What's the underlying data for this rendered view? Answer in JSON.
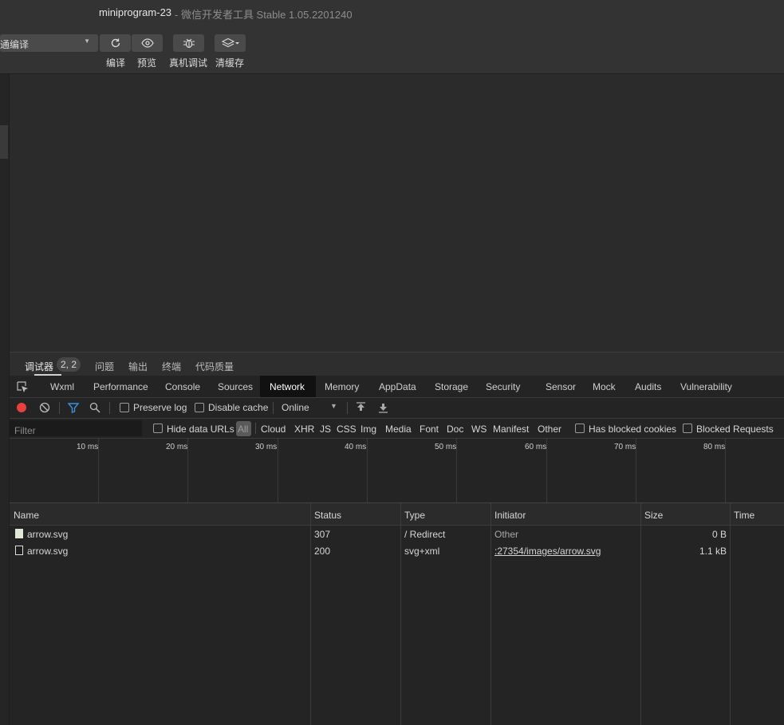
{
  "window": {
    "title": "miniprogram-23",
    "subtitle": "- 微信开发者工具 Stable 1.05.2201240"
  },
  "toolbar": {
    "compile_mode": "通编译",
    "buttons": [
      {
        "label": "编译",
        "icon": "refresh-icon"
      },
      {
        "label": "预览",
        "icon": "eye-icon"
      },
      {
        "label": "真机调试",
        "icon": "bug-icon"
      },
      {
        "label": "清缓存",
        "icon": "layers-icon"
      }
    ]
  },
  "panel_tabs": {
    "debugger": "调试器",
    "badge": "2, 2",
    "issues": "问题",
    "output": "输出",
    "terminal": "终端",
    "code_quality": "代码质量"
  },
  "devtools_tabs": [
    "Wxml",
    "Performance",
    "Console",
    "Sources",
    "Network",
    "Memory",
    "AppData",
    "Storage",
    "Security",
    "Sensor",
    "Mock",
    "Audits",
    "Vulnerability"
  ],
  "network_toolbar": {
    "preserve_log": "Preserve log",
    "disable_cache": "Disable cache",
    "throttling": "Online"
  },
  "filter_bar": {
    "placeholder": "Filter",
    "hide_data_urls": "Hide data URLs",
    "types": [
      "All",
      "Cloud",
      "XHR",
      "JS",
      "CSS",
      "Img",
      "Media",
      "Font",
      "Doc",
      "WS",
      "Manifest",
      "Other"
    ],
    "has_blocked_cookies": "Has blocked cookies",
    "blocked_requests": "Blocked Requests"
  },
  "overview": {
    "ticks": [
      "10 ms",
      "20 ms",
      "30 ms",
      "40 ms",
      "50 ms",
      "60 ms",
      "70 ms",
      "80 ms"
    ]
  },
  "table": {
    "columns": [
      "Name",
      "Status",
      "Type",
      "Initiator",
      "Size",
      "Time"
    ],
    "rows": [
      {
        "name": "arrow.svg",
        "status": "307",
        "type": "/ Redirect",
        "initiator": "Other",
        "size": "0 B"
      },
      {
        "name": "arrow.svg",
        "status": "200",
        "type": "svg+xml",
        "initiator": ":27354/images/arrow.svg",
        "size": "1.1 kB"
      }
    ]
  },
  "colors": {
    "record": "#e8413b",
    "filter_active": "#3d8fe0",
    "background": "#2b2b2b"
  }
}
